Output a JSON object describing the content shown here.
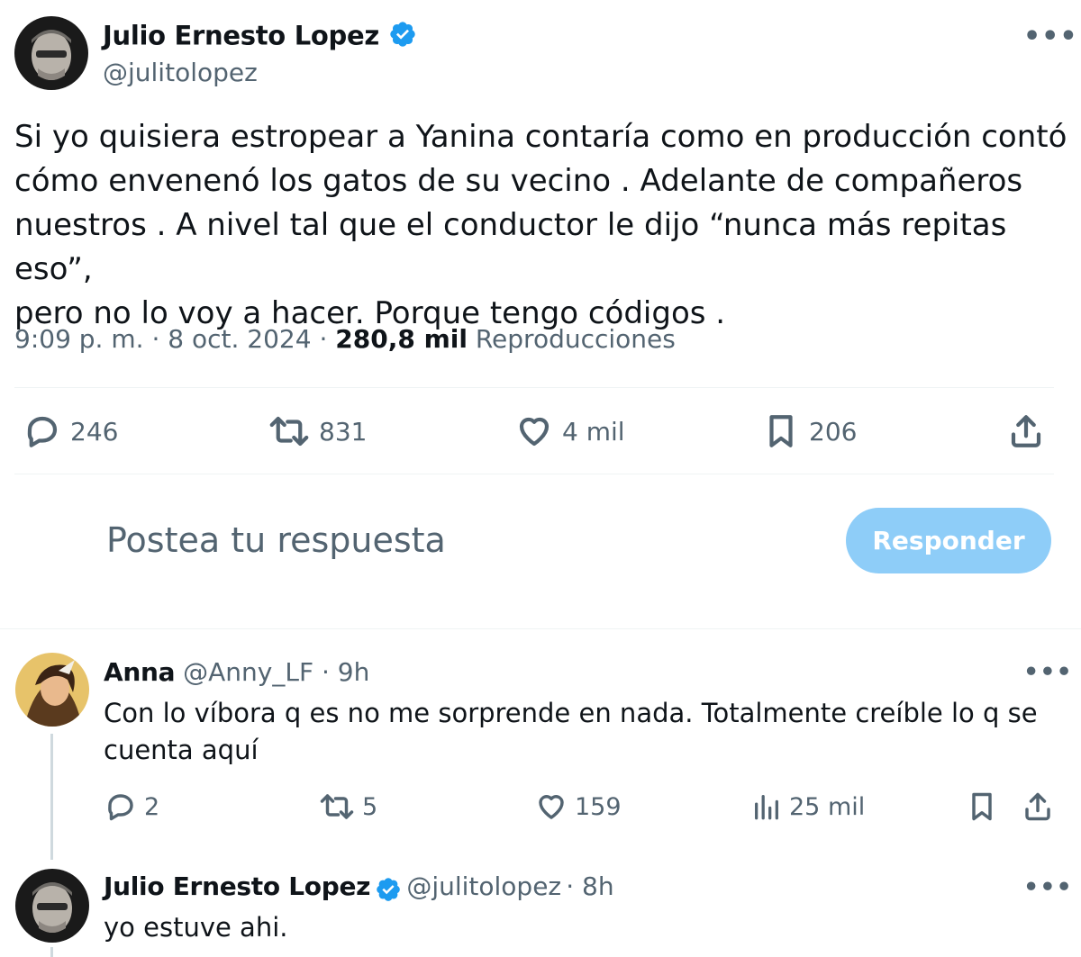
{
  "tweet": {
    "author_name": "Julio Ernesto Lopez",
    "author_handle": "@julitolopez",
    "verified_icon": "verified-badge-icon",
    "more_label": "•••",
    "text_lines": [
      "Si yo quisiera estropear a Yanina contaría como en producción contó",
      "cómo envenenó los gatos de su vecino . Adelante de compañeros",
      "nuestros . A nivel tal que el conductor le dijo “nunca más repitas eso”,",
      "pero no lo voy a hacer. Porque tengo códigos ."
    ],
    "time": "9:09 p. m.",
    "sep": "·",
    "date": "8 oct. 2024",
    "views_count": "280,8 mil",
    "views_label": "Reproducciones",
    "actions": {
      "replies": "246",
      "reposts": "831",
      "likes": "4 mil",
      "bookmarks": "206"
    }
  },
  "composer": {
    "placeholder": "Postea tu respuesta",
    "button_label": "Responder"
  },
  "replies": [
    {
      "author_name": "Anna",
      "author_handle": "@Anny_LF",
      "time": "· 9h",
      "text_lines": [
        "Con lo víbora q es no me sorprende en nada. Totalmente creíble lo q se",
        "cuenta aquí"
      ],
      "actions": {
        "replies": "2",
        "reposts": "5",
        "likes": "159",
        "views": "25 mil"
      }
    },
    {
      "author_name": "Julio Ernesto Lopez",
      "author_handle": "@julitolopez",
      "time": "· 8h",
      "text_lines": [
        "yo estuve ahi."
      ]
    }
  ],
  "colors": {
    "text": "#0f1419",
    "secondary": "#536471",
    "verified": "#1d9bf0",
    "reply_button": "#8ecdf8",
    "divider": "#eff3f4"
  }
}
